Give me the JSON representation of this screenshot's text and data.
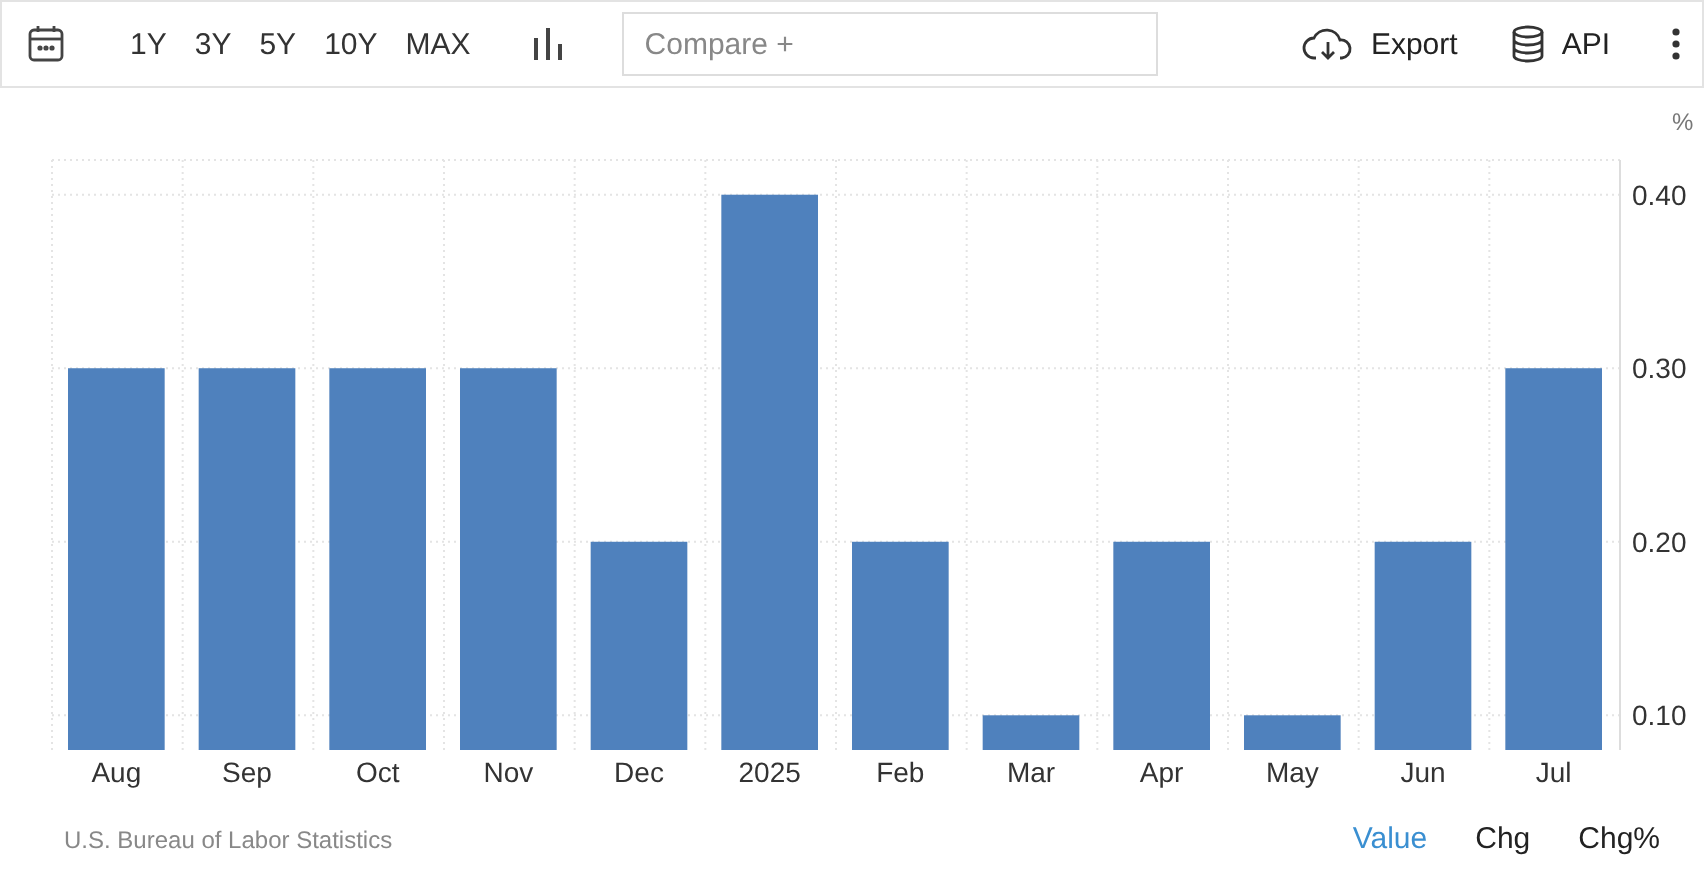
{
  "toolbar": {
    "periods": [
      "1Y",
      "3Y",
      "5Y",
      "10Y",
      "MAX"
    ],
    "compare": {
      "placeholder": "Compare +"
    },
    "export": "Export",
    "api": "API"
  },
  "chart": {
    "unit": "%",
    "chart_data": {
      "type": "bar",
      "categories": [
        "Aug",
        "Sep",
        "Oct",
        "Nov",
        "Dec",
        "2025",
        "Feb",
        "Mar",
        "Apr",
        "May",
        "Jun",
        "Jul"
      ],
      "grid": true,
      "series": [
        {
          "color": "#4f81bd",
          "values": [
            0.3,
            0.3,
            0.3,
            0.3,
            0.2,
            0.4,
            0.2,
            0.1,
            0.2,
            0.1,
            0.2,
            0.3
          ]
        }
      ],
      "ylim": [
        0.08,
        0.42
      ],
      "yticks": [
        {
          "value": 0.1,
          "label": "0.10"
        },
        {
          "value": 0.2,
          "label": "0.20"
        },
        {
          "value": 0.3,
          "label": "0.30"
        },
        {
          "value": 0.4,
          "label": "0.40"
        }
      ]
    }
  },
  "footer": {
    "source": "U.S. Bureau of Labor Statistics",
    "modes": [
      {
        "label": "Value",
        "selected": true
      },
      {
        "label": "Chg",
        "selected": false
      },
      {
        "label": "Chg%",
        "selected": false
      }
    ]
  }
}
